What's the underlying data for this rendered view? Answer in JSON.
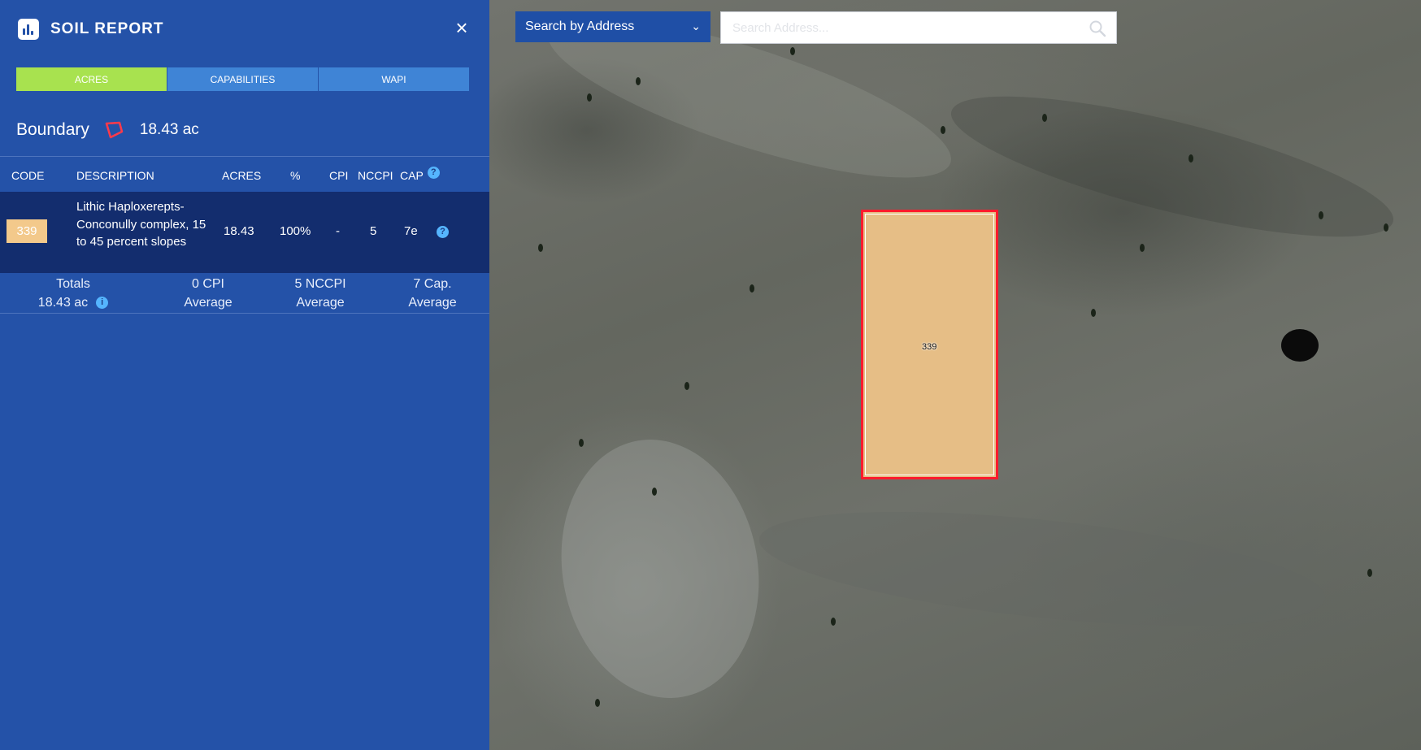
{
  "panel": {
    "title": "SOIL REPORT",
    "close_label": "×",
    "tabs": [
      {
        "label": "ACRES",
        "active": true
      },
      {
        "label": "CAPABILITIES",
        "active": false
      },
      {
        "label": "WAPI",
        "active": false
      }
    ],
    "boundary": {
      "label": "Boundary",
      "value": "18.43 ac"
    },
    "table": {
      "headers": [
        "CODE",
        "DESCRIPTION",
        "ACRES",
        "%",
        "CPI",
        "NCCPI",
        "CAP"
      ],
      "rows": [
        {
          "code": "339",
          "description": "Lithic Haploxerepts-Conconully complex, 15 to 45 percent slopes",
          "acres": "18.43",
          "percent": "100%",
          "cpi": "-",
          "nccpi": "5",
          "cap": "7e"
        }
      ],
      "totals": {
        "label": "Totals",
        "acres": "18.43 ac",
        "cpi": "0 CPI",
        "cpi_sub": "Average",
        "nccpi": "5 NCCPI",
        "nccpi_sub": "Average",
        "cap": "7 Cap.",
        "cap_sub": "Average"
      }
    },
    "colors": {
      "panel": "#2452a8",
      "active_tab": "#a8e24f",
      "tab": "#3f84d6",
      "row": "#132d6e",
      "code_badge": "#f3c98b"
    }
  },
  "map": {
    "search_select": {
      "label": "Search by Address"
    },
    "search_input": {
      "placeholder": "Search Address..."
    },
    "parcel": {
      "label": "339",
      "fill": "#e6be86",
      "stroke": "#ff1b2d"
    }
  }
}
